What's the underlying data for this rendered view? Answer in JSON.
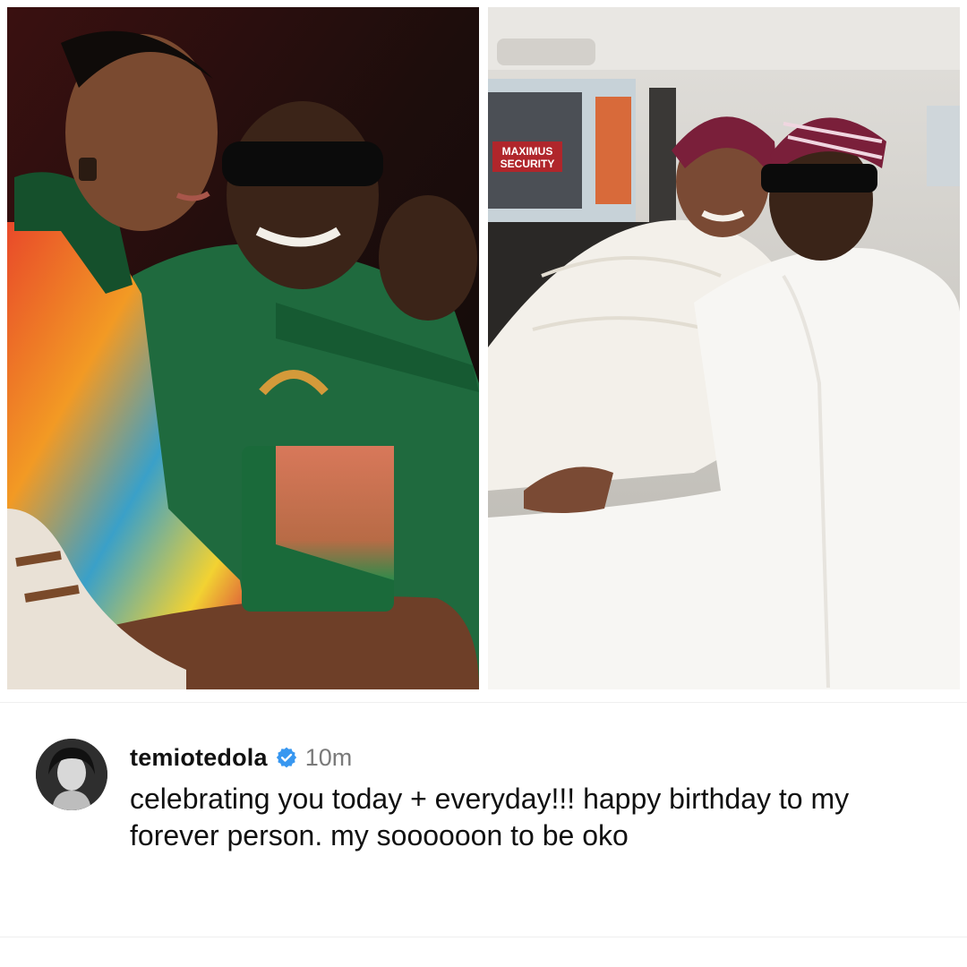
{
  "post": {
    "username": "temiotedola",
    "verified": true,
    "timestamp": "10m",
    "caption": "celebrating you today + everyday!!! happy birthday to my forever person. my soooooon to be oko"
  },
  "photos": {
    "left": {
      "sign_text": ""
    },
    "right": {
      "sign_text_line1": "MAXIMUS",
      "sign_text_line2": "SECURITY"
    }
  },
  "colors": {
    "verified_badge": "#3897f0",
    "text_primary": "#111111",
    "text_secondary": "#7a7a7a"
  }
}
